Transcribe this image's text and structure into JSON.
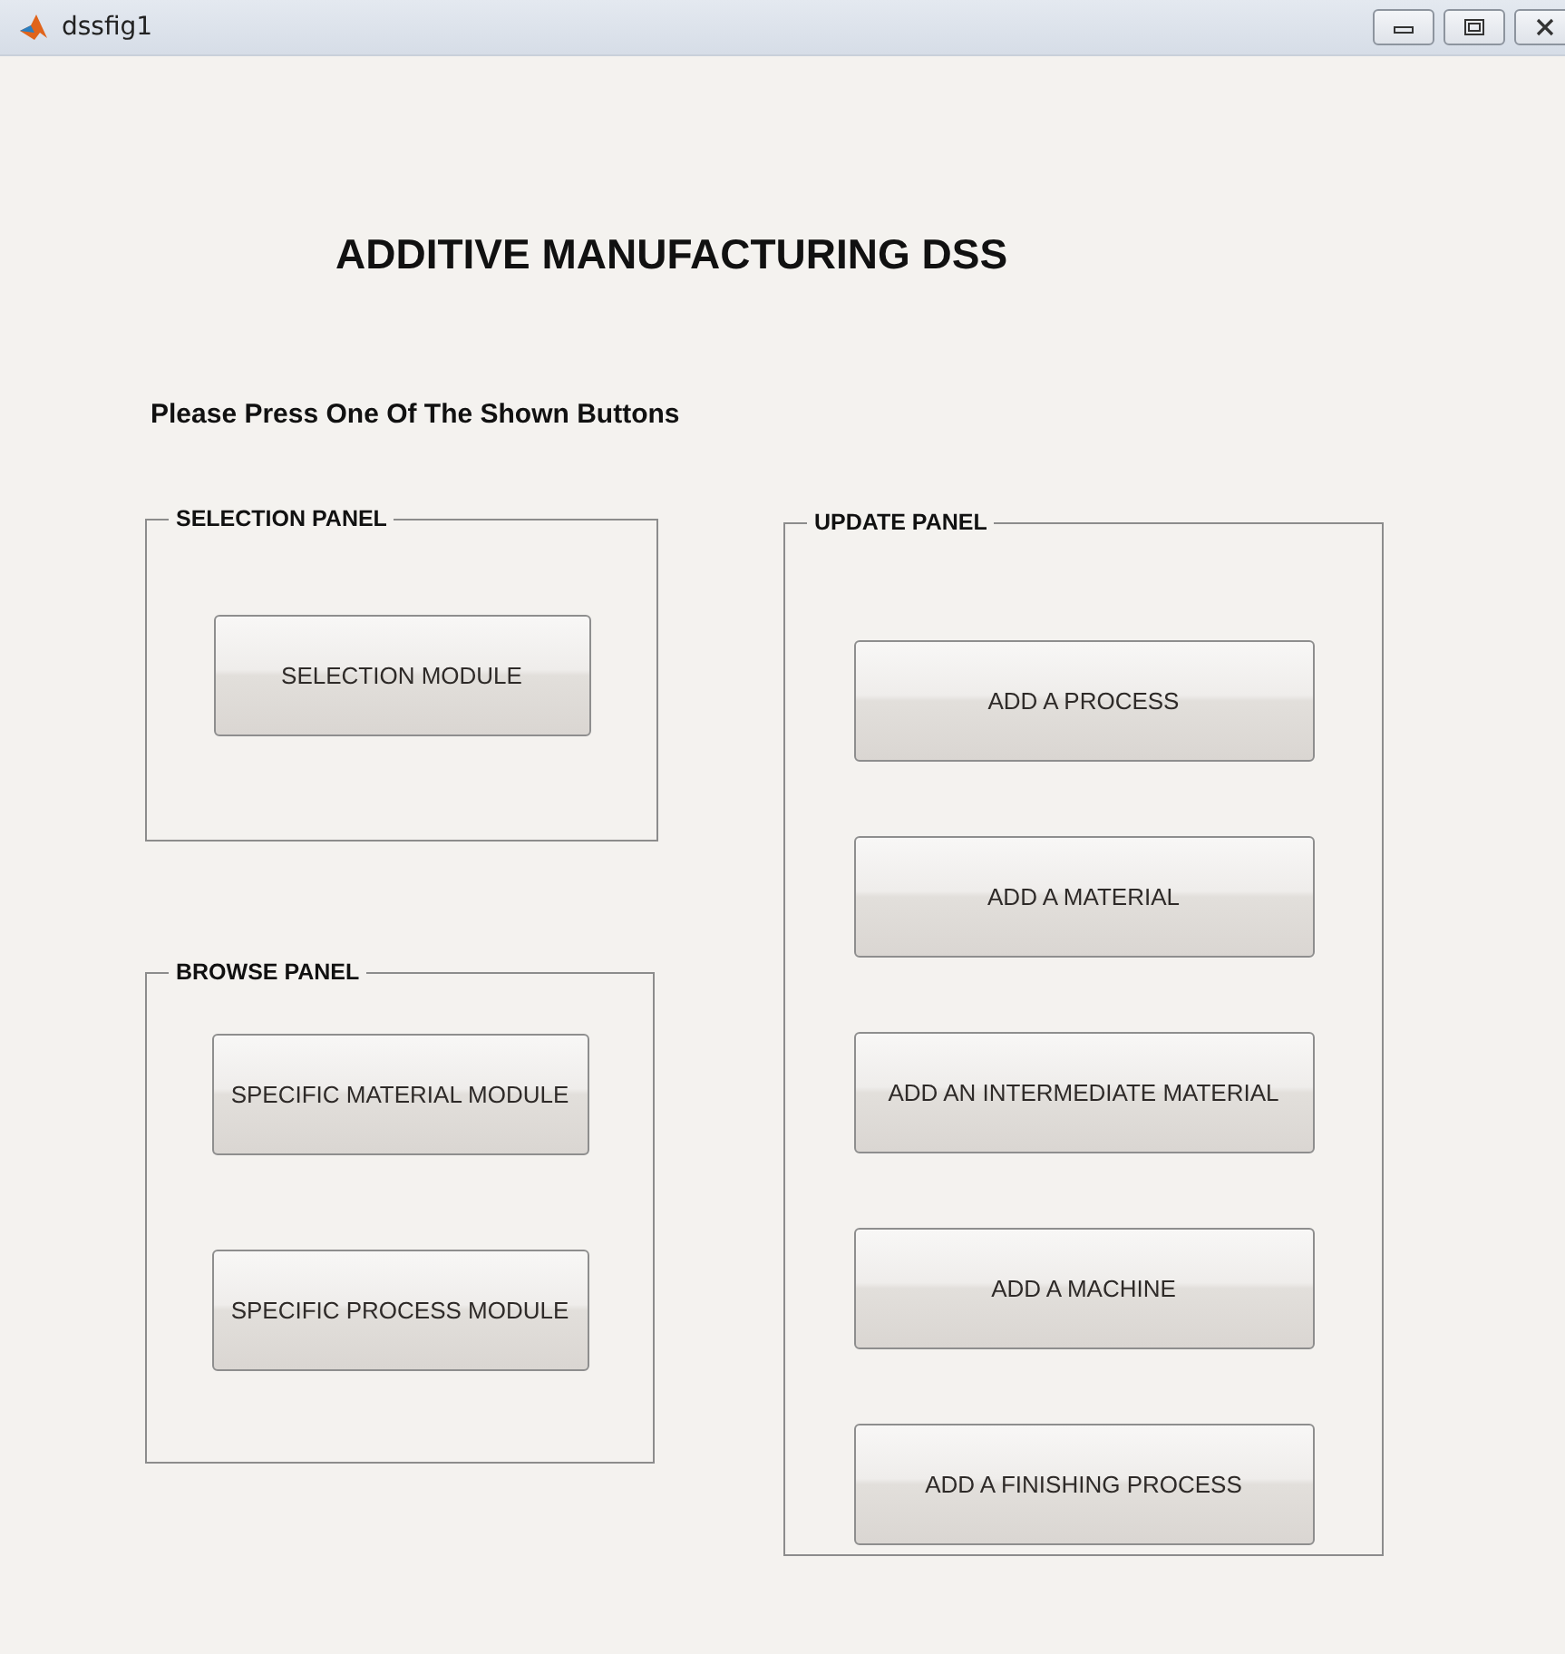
{
  "window": {
    "title": "dssfig1"
  },
  "heading": "ADDITIVE MANUFACTURING DSS",
  "prompt": "Please Press One Of The Shown Buttons",
  "columns": [
    {
      "panels": [
        {
          "title": "SELECTION PANEL",
          "buttons": [
            "SELECTION MODULE"
          ]
        },
        {
          "title": "BROWSE PANEL",
          "buttons": [
            "SPECIFIC MATERIAL MODULE",
            "SPECIFIC PROCESS MODULE"
          ]
        }
      ]
    },
    {
      "panels": [
        {
          "title": "UPDATE PANEL",
          "buttons": [
            "ADD A PROCESS",
            "ADD A MATERIAL",
            "ADD AN INTERMEDIATE MATERIAL",
            "ADD A MACHINE",
            "ADD A FINISHING PROCESS"
          ]
        }
      ]
    }
  ]
}
